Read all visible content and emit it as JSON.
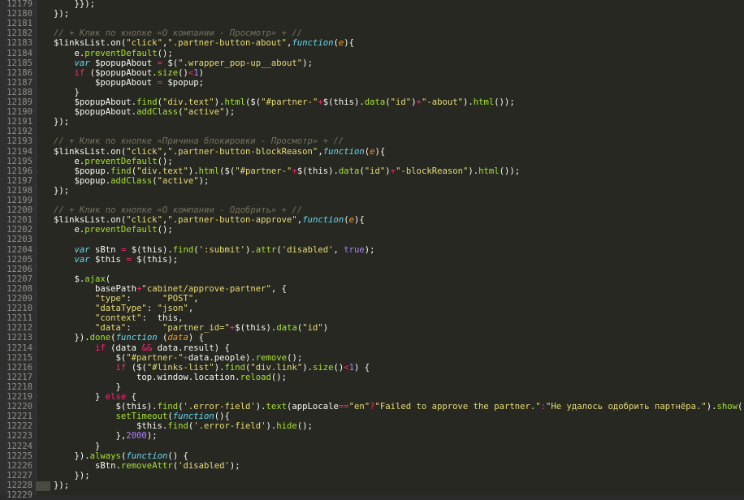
{
  "editor": {
    "lines": [
      {
        "n": "12179",
        "t": [
          [
            "t",
            "    }});"
          ]
        ]
      },
      {
        "n": "12180",
        "t": [
          [
            "t",
            "});"
          ]
        ]
      },
      {
        "n": "12181",
        "t": [
          [
            "t",
            ""
          ]
        ]
      },
      {
        "n": "12182",
        "t": [
          [
            "c",
            "// + Клик по кнопке «О компании - Просмотр» + //"
          ]
        ]
      },
      {
        "n": "12183",
        "t": [
          [
            "t",
            "$linksList.on("
          ],
          [
            "s",
            "\"click\""
          ],
          [
            "t",
            ","
          ],
          [
            "s",
            "\".partner-button-about\""
          ],
          [
            "t",
            ","
          ],
          [
            "k",
            "function"
          ],
          [
            "t",
            "("
          ],
          [
            "v",
            "e"
          ],
          [
            "t",
            "){"
          ]
        ]
      },
      {
        "n": "12184",
        "t": [
          [
            "t",
            "    e."
          ],
          [
            "f",
            "preventDefault"
          ],
          [
            "t",
            "();"
          ]
        ]
      },
      {
        "n": "12185",
        "t": [
          [
            "t",
            "    "
          ],
          [
            "k",
            "var"
          ],
          [
            "t",
            " $popupAbout "
          ],
          [
            "o",
            "="
          ],
          [
            "t",
            " $("
          ],
          [
            "s",
            "\".wrapper_pop-up__about\""
          ],
          [
            "t",
            ");"
          ]
        ]
      },
      {
        "n": "12186",
        "t": [
          [
            "t",
            "    "
          ],
          [
            "o",
            "if"
          ],
          [
            "t",
            " ($popupAbout."
          ],
          [
            "f",
            "size"
          ],
          [
            "t",
            "()"
          ],
          [
            "o",
            "<"
          ],
          [
            "n",
            "1"
          ],
          [
            "t",
            ")"
          ]
        ]
      },
      {
        "n": "12187",
        "t": [
          [
            "t",
            "        $popupAbout "
          ],
          [
            "o",
            "="
          ],
          [
            "t",
            " $popup;"
          ]
        ]
      },
      {
        "n": "12188",
        "t": [
          [
            "t",
            "    }"
          ]
        ]
      },
      {
        "n": "12189",
        "t": [
          [
            "t",
            "    $popupAbout."
          ],
          [
            "f",
            "find"
          ],
          [
            "t",
            "("
          ],
          [
            "s",
            "\"div.text\""
          ],
          [
            "t",
            ")."
          ],
          [
            "f",
            "html"
          ],
          [
            "t",
            "($("
          ],
          [
            "s",
            "\"#partner-\""
          ],
          [
            "o",
            "+"
          ],
          [
            "t",
            "$(this)."
          ],
          [
            "f",
            "data"
          ],
          [
            "t",
            "("
          ],
          [
            "s",
            "\"id\""
          ],
          [
            "t",
            ")"
          ],
          [
            "o",
            "+"
          ],
          [
            "s",
            "\"-about\""
          ],
          [
            "t",
            ")."
          ],
          [
            "f",
            "html"
          ],
          [
            "t",
            "());"
          ]
        ]
      },
      {
        "n": "12190",
        "t": [
          [
            "t",
            "    $popupAbout."
          ],
          [
            "f",
            "addClass"
          ],
          [
            "t",
            "("
          ],
          [
            "s",
            "\"active\""
          ],
          [
            "t",
            ");"
          ]
        ]
      },
      {
        "n": "12191",
        "t": [
          [
            "t",
            "});"
          ]
        ]
      },
      {
        "n": "12192",
        "t": [
          [
            "t",
            ""
          ]
        ]
      },
      {
        "n": "12193",
        "t": [
          [
            "c",
            "// + Клик по кнопке «Причина блокировки - Просмотр» + //"
          ]
        ]
      },
      {
        "n": "12194",
        "t": [
          [
            "t",
            "$linksList.on("
          ],
          [
            "s",
            "\"click\""
          ],
          [
            "t",
            ","
          ],
          [
            "s",
            "\".partner-button-blockReason\""
          ],
          [
            "t",
            ","
          ],
          [
            "k",
            "function"
          ],
          [
            "t",
            "("
          ],
          [
            "v",
            "e"
          ],
          [
            "t",
            "){"
          ]
        ]
      },
      {
        "n": "12195",
        "t": [
          [
            "t",
            "    e."
          ],
          [
            "f",
            "preventDefault"
          ],
          [
            "t",
            "();"
          ]
        ]
      },
      {
        "n": "12196",
        "t": [
          [
            "t",
            "    $popup."
          ],
          [
            "f",
            "find"
          ],
          [
            "t",
            "("
          ],
          [
            "s",
            "\"div.text\""
          ],
          [
            "t",
            ")."
          ],
          [
            "f",
            "html"
          ],
          [
            "t",
            "($("
          ],
          [
            "s",
            "\"#partner-\""
          ],
          [
            "o",
            "+"
          ],
          [
            "t",
            "$(this)."
          ],
          [
            "f",
            "data"
          ],
          [
            "t",
            "("
          ],
          [
            "s",
            "\"id\""
          ],
          [
            "t",
            ")"
          ],
          [
            "o",
            "+"
          ],
          [
            "s",
            "\"-blockReason\""
          ],
          [
            "t",
            ")."
          ],
          [
            "f",
            "html"
          ],
          [
            "t",
            "());"
          ]
        ]
      },
      {
        "n": "12197",
        "t": [
          [
            "t",
            "    $popup."
          ],
          [
            "f",
            "addClass"
          ],
          [
            "t",
            "("
          ],
          [
            "s",
            "\"active\""
          ],
          [
            "t",
            ");"
          ]
        ]
      },
      {
        "n": "12198",
        "t": [
          [
            "t",
            "});"
          ]
        ]
      },
      {
        "n": "12199",
        "t": [
          [
            "t",
            ""
          ]
        ]
      },
      {
        "n": "12200",
        "t": [
          [
            "c",
            "// + Клик по кнопке «О компании - Одобрить» + //"
          ]
        ]
      },
      {
        "n": "12201",
        "t": [
          [
            "t",
            "$linksList.on("
          ],
          [
            "s",
            "\"click\""
          ],
          [
            "t",
            ","
          ],
          [
            "s",
            "\".partner-button-approve\""
          ],
          [
            "t",
            ","
          ],
          [
            "k",
            "function"
          ],
          [
            "t",
            "("
          ],
          [
            "v",
            "e"
          ],
          [
            "t",
            "){"
          ]
        ]
      },
      {
        "n": "12202",
        "t": [
          [
            "t",
            "    e."
          ],
          [
            "f",
            "preventDefault"
          ],
          [
            "t",
            "();"
          ]
        ]
      },
      {
        "n": "12203",
        "t": [
          [
            "t",
            ""
          ]
        ]
      },
      {
        "n": "12204",
        "t": [
          [
            "t",
            "    "
          ],
          [
            "k",
            "var"
          ],
          [
            "t",
            " sBtn "
          ],
          [
            "o",
            "="
          ],
          [
            "t",
            " $(this)."
          ],
          [
            "f",
            "find"
          ],
          [
            "t",
            "("
          ],
          [
            "s",
            "':submit'"
          ],
          [
            "t",
            ")."
          ],
          [
            "f",
            "attr"
          ],
          [
            "t",
            "("
          ],
          [
            "s",
            "'disabled'"
          ],
          [
            "t",
            ", "
          ],
          [
            "n",
            "true"
          ],
          [
            "t",
            ");"
          ]
        ]
      },
      {
        "n": "12205",
        "t": [
          [
            "t",
            "    "
          ],
          [
            "k",
            "var"
          ],
          [
            "t",
            " $this "
          ],
          [
            "o",
            "="
          ],
          [
            "t",
            " $(this);"
          ]
        ]
      },
      {
        "n": "12206",
        "t": [
          [
            "t",
            ""
          ]
        ]
      },
      {
        "n": "12207",
        "t": [
          [
            "t",
            "    $."
          ],
          [
            "f",
            "ajax"
          ],
          [
            "t",
            "("
          ]
        ]
      },
      {
        "n": "12208",
        "t": [
          [
            "t",
            "        basePath"
          ],
          [
            "o",
            "+"
          ],
          [
            "s",
            "\"cabinet/approve-partner\""
          ],
          [
            "t",
            ", {"
          ]
        ]
      },
      {
        "n": "12209",
        "t": [
          [
            "t",
            "        "
          ],
          [
            "s",
            "\"type\""
          ],
          [
            "t",
            ":      "
          ],
          [
            "s",
            "\"POST\""
          ],
          [
            "t",
            ","
          ]
        ]
      },
      {
        "n": "12210",
        "t": [
          [
            "t",
            "        "
          ],
          [
            "s",
            "\"dataType\""
          ],
          [
            "t",
            ": "
          ],
          [
            "s",
            "\"json\""
          ],
          [
            "t",
            ","
          ]
        ]
      },
      {
        "n": "12211",
        "t": [
          [
            "t",
            "        "
          ],
          [
            "s",
            "\"context\""
          ],
          [
            "t",
            ":  this,"
          ]
        ]
      },
      {
        "n": "12212",
        "t": [
          [
            "t",
            "        "
          ],
          [
            "s",
            "\"data\""
          ],
          [
            "t",
            ":      "
          ],
          [
            "s",
            "\"partner_id=\""
          ],
          [
            "o",
            "+"
          ],
          [
            "t",
            "$(this)."
          ],
          [
            "f",
            "data"
          ],
          [
            "t",
            "("
          ],
          [
            "s",
            "\"id\""
          ],
          [
            "t",
            ")"
          ]
        ]
      },
      {
        "n": "12213",
        "t": [
          [
            "t",
            "    })."
          ],
          [
            "f",
            "done"
          ],
          [
            "t",
            "("
          ],
          [
            "k",
            "function"
          ],
          [
            "t",
            " ("
          ],
          [
            "v",
            "data"
          ],
          [
            "t",
            ") {"
          ]
        ]
      },
      {
        "n": "12214",
        "t": [
          [
            "t",
            "        "
          ],
          [
            "o",
            "if"
          ],
          [
            "t",
            " (data "
          ],
          [
            "o",
            "&&"
          ],
          [
            "t",
            " data.result) {"
          ]
        ]
      },
      {
        "n": "12215",
        "t": [
          [
            "t",
            "            $("
          ],
          [
            "s",
            "\"#partner-\""
          ],
          [
            "o",
            "+"
          ],
          [
            "t",
            "data.people)."
          ],
          [
            "f",
            "remove"
          ],
          [
            "t",
            "();"
          ]
        ]
      },
      {
        "n": "12216",
        "t": [
          [
            "t",
            "            "
          ],
          [
            "o",
            "if"
          ],
          [
            "t",
            " ($("
          ],
          [
            "s",
            "\"#links-list\""
          ],
          [
            "t",
            ")."
          ],
          [
            "f",
            "find"
          ],
          [
            "t",
            "("
          ],
          [
            "s",
            "\"div.link\""
          ],
          [
            "t",
            ")."
          ],
          [
            "f",
            "size"
          ],
          [
            "t",
            "()"
          ],
          [
            "o",
            "<"
          ],
          [
            "n",
            "1"
          ],
          [
            "t",
            ") {"
          ]
        ]
      },
      {
        "n": "12217",
        "t": [
          [
            "t",
            "                top.window.location."
          ],
          [
            "f",
            "reload"
          ],
          [
            "t",
            "();"
          ]
        ]
      },
      {
        "n": "12218",
        "t": [
          [
            "t",
            "            }"
          ]
        ]
      },
      {
        "n": "12219",
        "t": [
          [
            "t",
            "        } "
          ],
          [
            "o",
            "else"
          ],
          [
            "t",
            " {"
          ]
        ]
      },
      {
        "n": "12220",
        "t": [
          [
            "t",
            "            $(this)."
          ],
          [
            "f",
            "find"
          ],
          [
            "t",
            "("
          ],
          [
            "s",
            "'.error-field'"
          ],
          [
            "t",
            ")."
          ],
          [
            "f",
            "text"
          ],
          [
            "t",
            "(appLocale"
          ],
          [
            "o",
            "=="
          ],
          [
            "s",
            "\"en\""
          ],
          [
            "o",
            "?"
          ],
          [
            "s",
            "\"Failed to approve the partner.\""
          ],
          [
            "o",
            ":"
          ],
          [
            "s",
            "\"Не удалось одобрить партнёра.\""
          ],
          [
            "t",
            ")."
          ],
          [
            "f",
            "show"
          ],
          [
            "t",
            "();"
          ]
        ]
      },
      {
        "n": "12221",
        "t": [
          [
            "t",
            "            "
          ],
          [
            "f",
            "setTimeout"
          ],
          [
            "t",
            "("
          ],
          [
            "k",
            "function"
          ],
          [
            "t",
            "(){"
          ]
        ]
      },
      {
        "n": "12222",
        "t": [
          [
            "t",
            "                $this."
          ],
          [
            "f",
            "find"
          ],
          [
            "t",
            "("
          ],
          [
            "s",
            "'.error-field'"
          ],
          [
            "t",
            ")."
          ],
          [
            "f",
            "hide"
          ],
          [
            "t",
            "();"
          ]
        ]
      },
      {
        "n": "12223",
        "t": [
          [
            "t",
            "            },"
          ],
          [
            "n",
            "2000"
          ],
          [
            "t",
            ");"
          ]
        ]
      },
      {
        "n": "12224",
        "t": [
          [
            "t",
            "        }"
          ]
        ]
      },
      {
        "n": "12225",
        "t": [
          [
            "t",
            "    })."
          ],
          [
            "f",
            "always"
          ],
          [
            "t",
            "("
          ],
          [
            "k",
            "function"
          ],
          [
            "t",
            "() {"
          ]
        ]
      },
      {
        "n": "12226",
        "t": [
          [
            "t",
            "        sBtn."
          ],
          [
            "f",
            "removeAttr"
          ],
          [
            "t",
            "("
          ],
          [
            "s",
            "'disabled'"
          ],
          [
            "t",
            ");"
          ]
        ]
      },
      {
        "n": "12227",
        "t": [
          [
            "t",
            "    });"
          ]
        ]
      },
      {
        "n": "12228",
        "t": [
          [
            "t",
            "});"
          ]
        ]
      },
      {
        "n": "12229",
        "t": [
          [
            "t",
            ""
          ]
        ]
      }
    ]
  }
}
